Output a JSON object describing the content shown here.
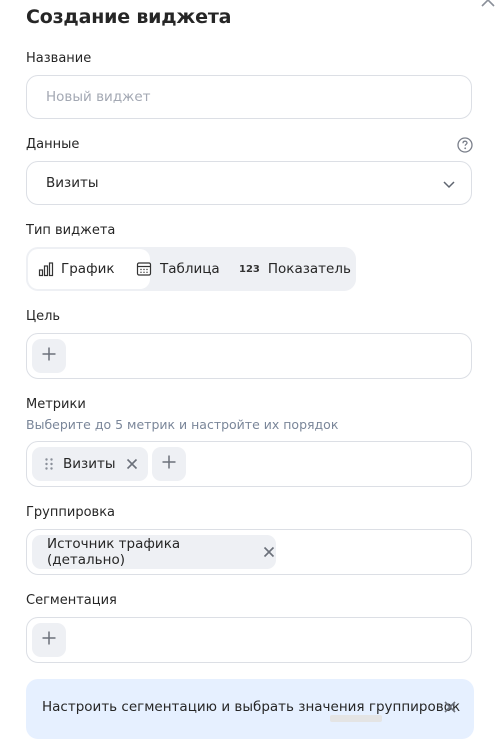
{
  "title": "Создание виджета",
  "name_section": {
    "label": "Название",
    "placeholder": "Новый виджет"
  },
  "data_section": {
    "label": "Данные",
    "selected": "Визиты",
    "help_icon": "question-circle-icon"
  },
  "widget_type": {
    "label": "Тип виджета",
    "options": [
      {
        "label": "График",
        "icon": "bar-chart-icon",
        "selected": true
      },
      {
        "label": "Таблица",
        "icon": "table-icon",
        "selected": false
      },
      {
        "label": "Показатель",
        "icon_text": "123",
        "selected": false
      }
    ]
  },
  "goal_section": {
    "label": "Цель"
  },
  "metrics_section": {
    "label": "Метрики",
    "hint": "Выберите до 5 метрик и настройте их порядок",
    "chips": [
      {
        "label": "Визиты"
      }
    ]
  },
  "grouping_section": {
    "label": "Группировка",
    "chips": [
      {
        "label": "Источник трафика (детально)"
      }
    ]
  },
  "segmentation_section": {
    "label": "Сегментация"
  },
  "banner": {
    "text": "Настроить сегментацию и выбрать значения группировок"
  },
  "colors": {
    "accent_bg": "#e6f0ff",
    "chip_bg": "#eef0f4",
    "border": "#dcdfe5",
    "hint": "#7a8699"
  }
}
